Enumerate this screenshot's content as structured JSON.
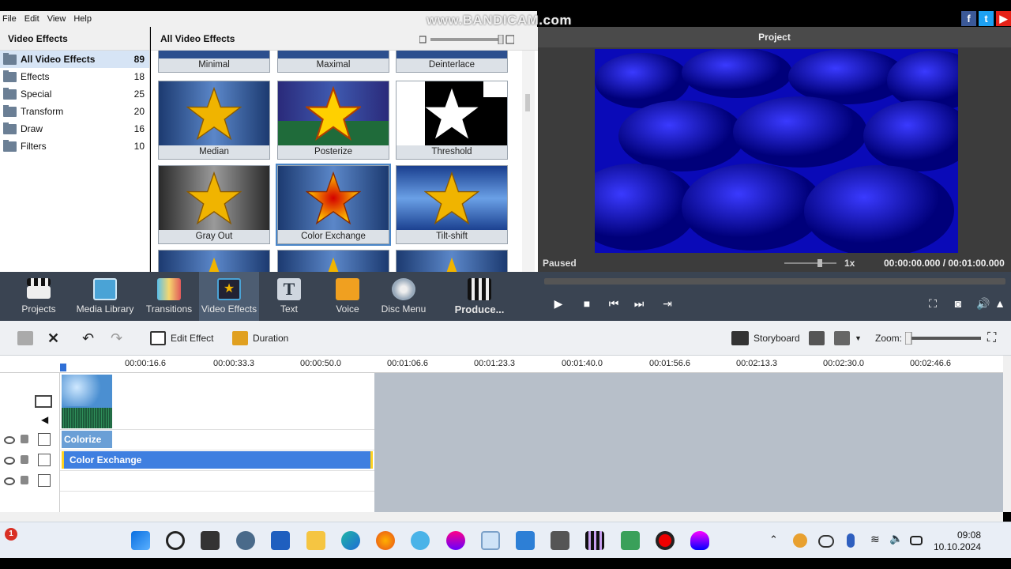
{
  "menu": [
    "File",
    "Edit",
    "View",
    "Help"
  ],
  "watermark": "www.BANDICAM.com",
  "categories": {
    "title": "Video Effects",
    "items": [
      {
        "label": "All Video Effects",
        "count": "89"
      },
      {
        "label": "Effects",
        "count": "18"
      },
      {
        "label": "Special",
        "count": "25"
      },
      {
        "label": "Transform",
        "count": "20"
      },
      {
        "label": "Draw",
        "count": "16"
      },
      {
        "label": "Filters",
        "count": "10"
      }
    ]
  },
  "effects": {
    "title": "All Video Effects",
    "tiles": [
      "Minimal",
      "Maximal",
      "Deinterlace",
      "Median",
      "Posterize",
      "Threshold",
      "Gray Out",
      "Color Exchange",
      "Tilt-shift"
    ],
    "selected": "Color Exchange"
  },
  "preview": {
    "title": "Project",
    "status": "Paused",
    "speed": "1x",
    "time": "00:00:00.000 / 00:01:00.000"
  },
  "toolbar": {
    "items": [
      "Projects",
      "Media Library",
      "Transitions",
      "Video Effects",
      "Text",
      "Voice",
      "Disc Menu",
      "Produce..."
    ],
    "active": "Video Effects"
  },
  "timeline_bar": {
    "edit_effect": "Edit Effect",
    "duration": "Duration",
    "storyboard": "Storyboard",
    "zoom": "Zoom:"
  },
  "ruler": [
    "00:00:16.6",
    "00:00:33.3",
    "00:00:50.0",
    "00:01:06.6",
    "00:01:23.3",
    "00:01:40.0",
    "00:01:56.6",
    "00:02:13.3",
    "00:02:30.0",
    "00:02:46.6"
  ],
  "tracks": {
    "colorize": "Colorize",
    "color_exchange": "Color Exchange"
  },
  "taskbar": {
    "time": "09:08",
    "date": "10.10.2024",
    "notification_count": "1"
  },
  "colors": {
    "accent": "#3f7fe0",
    "toolbar": "#3a4452",
    "preview_blue": "#1a1ad4"
  }
}
